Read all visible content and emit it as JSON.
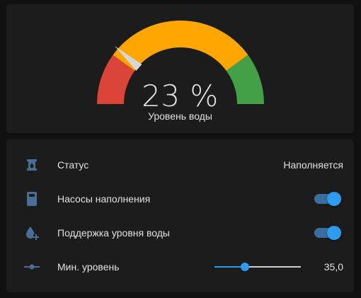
{
  "gauge": {
    "value_text": "23 %",
    "value_fraction": 0.23,
    "name": "Уровень воды",
    "colors": {
      "low": "#db4437",
      "mid": "#ffa600",
      "high": "#43a047",
      "needle": "#d6d6d6"
    }
  },
  "entities": [
    {
      "icon": "water-tank-icon",
      "label": "Статус",
      "state": "Наполняется",
      "type": "text"
    },
    {
      "icon": "pump-remote-icon",
      "label": "Насосы наполнения",
      "state": "on",
      "type": "toggle"
    },
    {
      "icon": "water-plus-icon",
      "label": "Поддержка уровня воды",
      "state": "on",
      "type": "toggle"
    },
    {
      "icon": "slider-icon",
      "label": "Мин. уровень",
      "state": "35,0",
      "type": "slider",
      "fraction": 0.35
    }
  ],
  "colors": {
    "accent": "#2d9cef",
    "icon": "#4a6f96",
    "card": "#1c1c1c",
    "background": "#111111"
  }
}
